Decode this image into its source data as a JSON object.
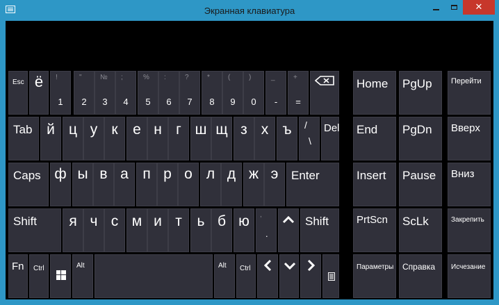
{
  "window": {
    "title": "Экранная клавиатура",
    "close_glyph": "✕"
  },
  "colors": {
    "title_bar": "#2e97c6",
    "close_button": "#c7372b",
    "key_background": "#30303a",
    "panel_background": "#000000",
    "secondary_text": "#8a8a92"
  },
  "keys": {
    "esc": "Esc",
    "yo": "ё",
    "row1": [
      {
        "main": "1",
        "shift": "!"
      },
      {
        "main": "2",
        "shift": "\""
      },
      {
        "main": "3",
        "shift": "№"
      },
      {
        "main": "4",
        "shift": ";"
      },
      {
        "main": "5",
        "shift": "%"
      },
      {
        "main": "6",
        "shift": ":"
      },
      {
        "main": "7",
        "shift": "?"
      },
      {
        "main": "8",
        "shift": "*"
      },
      {
        "main": "9",
        "shift": "("
      },
      {
        "main": "0",
        "shift": ")"
      },
      {
        "main": "-",
        "shift": "_"
      },
      {
        "main": "=",
        "shift": "+"
      }
    ],
    "backspace_icon": "backspace-icon",
    "tab": "Tab",
    "row2": [
      "й",
      "ц",
      "у",
      "к",
      "е",
      "н",
      "г",
      "ш",
      "щ",
      "з",
      "х",
      "ъ"
    ],
    "slash_top": "/",
    "slash_bottom": "\\",
    "del": "Del",
    "caps": "Caps",
    "row3": [
      "ф",
      "ы",
      "в",
      "а",
      "п",
      "р",
      "о",
      "л",
      "д",
      "ж",
      "э"
    ],
    "enter": "Enter",
    "shift": "Shift",
    "row4": [
      "я",
      "ч",
      "с",
      "м",
      "и",
      "т",
      "ь",
      "б",
      "ю"
    ],
    "comma_top": ",",
    "comma_bottom": ".",
    "up_arrow_icon": "up-arrow-icon",
    "fn": "Fn",
    "ctrl": "Ctrl",
    "windows_icon": "windows-logo-icon",
    "alt": "Alt",
    "left_arrow_icon": "left-arrow-icon",
    "down_arrow_icon": "down-arrow-icon",
    "right_arrow_icon": "right-arrow-icon",
    "menu_icon": "menu-icon"
  },
  "nav": {
    "home": "Home",
    "pgup": "PgUp",
    "end": "End",
    "pgdn": "PgDn",
    "insert": "Insert",
    "pause": "Pause",
    "prtscn": "PrtScn",
    "sclk": "ScLk",
    "options": "Параметры",
    "help": "Справка"
  },
  "side": {
    "go": "Перейти",
    "up": "Вверх",
    "down": "Вниз",
    "dock": "Закрепить",
    "fade": "Исчезание"
  }
}
